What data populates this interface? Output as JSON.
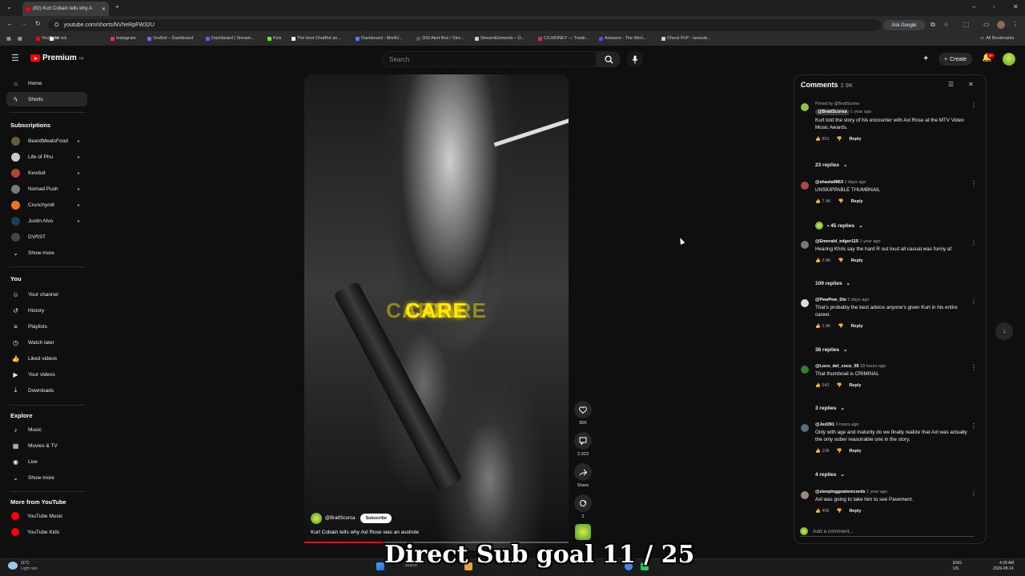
{
  "browser": {
    "tab_title": "(82) Kurt Cobain tells why A",
    "url": "youtube.com/shorts/NVheRpFW32U",
    "ask_google": "Ask Google",
    "all_bookmarks": "All Bookmarks",
    "bookmarks": [
      {
        "label": "YouTube",
        "color": "#ff0000"
      },
      {
        "label": "tik tok",
        "color": "#ffffff"
      },
      {
        "label": "Instagram",
        "color": "#e1306c"
      },
      {
        "label": "VoxBot – Dashboard",
        "color": "#8a5cf6"
      },
      {
        "label": "Dashboard | Stream...",
        "color": "#5865f2"
      },
      {
        "label": "Kick",
        "color": "#53fc18"
      },
      {
        "label": "The best ChatBot an...",
        "color": "#ffffff"
      },
      {
        "label": "Dashboard - MixItU...",
        "color": "#4f7cff"
      },
      {
        "label": "(59) Alert Box / Stre...",
        "color": "#555555"
      },
      {
        "label": "StreamElements – D...",
        "color": "#cccccc"
      },
      {
        "label": "CS.MONEY — Trade...",
        "color": "#e0245e"
      },
      {
        "label": "Aniwave - The Worl...",
        "color": "#6a3cff"
      },
      {
        "label": "Check PvP - Iamsob...",
        "color": "#cccccc"
      }
    ]
  },
  "yt": {
    "logo": "Premium",
    "logo_sup": "CA",
    "search_placeholder": "Search",
    "create": "Create",
    "notif_count": "9+"
  },
  "sidebar": {
    "main": [
      {
        "label": "Home",
        "icon": "home-icon"
      },
      {
        "label": "Shorts",
        "icon": "shorts-icon"
      }
    ],
    "subscriptions_title": "Subscriptions",
    "subscriptions": [
      {
        "label": "BeardMeatsFood",
        "color": "#6b5a3e"
      },
      {
        "label": "Life of Phu",
        "color": "#c9c9c9"
      },
      {
        "label": "Kevduit",
        "color": "#b0462a"
      },
      {
        "label": "Nomad Push",
        "color": "#7a7a7a"
      },
      {
        "label": "Crunchyroll",
        "color": "#f47521"
      },
      {
        "label": "Justin Alvo",
        "color": "#1f3a5a"
      },
      {
        "label": "DVRST",
        "color": "#444444"
      }
    ],
    "show_more": "Show more",
    "you_title": "You",
    "you": [
      {
        "label": "Your channel",
        "icon": "person-icon"
      },
      {
        "label": "History",
        "icon": "history-icon"
      },
      {
        "label": "Playlists",
        "icon": "playlist-icon"
      },
      {
        "label": "Watch later",
        "icon": "clock-icon"
      },
      {
        "label": "Liked videos",
        "icon": "thumbs-up-icon"
      },
      {
        "label": "Your videos",
        "icon": "video-icon"
      },
      {
        "label": "Downloads",
        "icon": "download-icon"
      }
    ],
    "explore_title": "Explore",
    "explore": [
      {
        "label": "Music",
        "icon": "music-icon"
      },
      {
        "label": "Movies & TV",
        "icon": "film-icon"
      },
      {
        "label": "Live",
        "icon": "live-icon"
      }
    ],
    "show_more2": "Show more",
    "more_title": "More from YouTube",
    "more": [
      {
        "label": "YouTube Music"
      },
      {
        "label": "YouTube Kids"
      }
    ]
  },
  "video": {
    "caption_word": "CARE",
    "channel": "@BrattScorsa",
    "subscribe": "Subscribe",
    "title": "Kurt Cobain tells why Axl Rose was an asshole",
    "progress": 0.3
  },
  "actions": {
    "likes": "36K",
    "comments": "2,923",
    "share": "Share",
    "remix": "2"
  },
  "comments": {
    "title": "Comments",
    "count": "2.9K",
    "add_placeholder": "Add a comment...",
    "items": [
      {
        "pinned": "Pinned by @BrattScorsa",
        "author": "@BrattScorsa",
        "time": "1 year ago",
        "text": "Kurt told the story of his encounter with Axl Rose at the MTV Video Music Awards.",
        "likes": "801",
        "replies": "23 replies",
        "color": "#8bc34a"
      },
      {
        "author": "@shasta9863",
        "time": "2 days ago",
        "text": "UNSKIPPABLE THUMBNAIL",
        "likes": "7.9K",
        "replies": "• 45 replies",
        "color": "#b04a4a"
      },
      {
        "author": "@Emerald_edger115",
        "time": "1 year ago",
        "text": "Hearing Khris say the hard R out loud all casual was funny af",
        "likes": "2.8K",
        "replies": "109 replies",
        "color": "#777777"
      },
      {
        "author": "@PewPew_Die",
        "time": "2 days ago",
        "text": "That's probably the best advice anyone's given Kurt in his entire career.",
        "likes": "1.8K",
        "replies": "36 replies",
        "color": "#dddddd"
      },
      {
        "author": "@Loco_del_coco_05",
        "time": "18 hours ago",
        "text": "That thumbnail is CRIMINAL",
        "likes": "542",
        "replies": "3 replies",
        "color": "#2e7d32"
      },
      {
        "author": "@Jed391",
        "time": "6 hours ago",
        "text": "Only with age and maturity do we finally realize that Axl was actually the only sober reasonable one in the story.",
        "likes": "108",
        "replies": "4 replies",
        "color": "#546e7a"
      },
      {
        "author": "@sleepinggoatsrecords",
        "time": "1 year ago",
        "text": "Axl was going to take him to see Pavement.",
        "likes": "405",
        "replies": "",
        "color": "#a1887f"
      }
    ],
    "reply_label": "Reply"
  },
  "overlay_text": "Direct Sub goal 11 / 25",
  "taskbar": {
    "weather_temp": "11°C",
    "weather_desc": "Light rain",
    "search": "Search",
    "lang1": "ENG",
    "lang2": "US",
    "time": "4:28 AM",
    "date": "2026-08-14"
  }
}
